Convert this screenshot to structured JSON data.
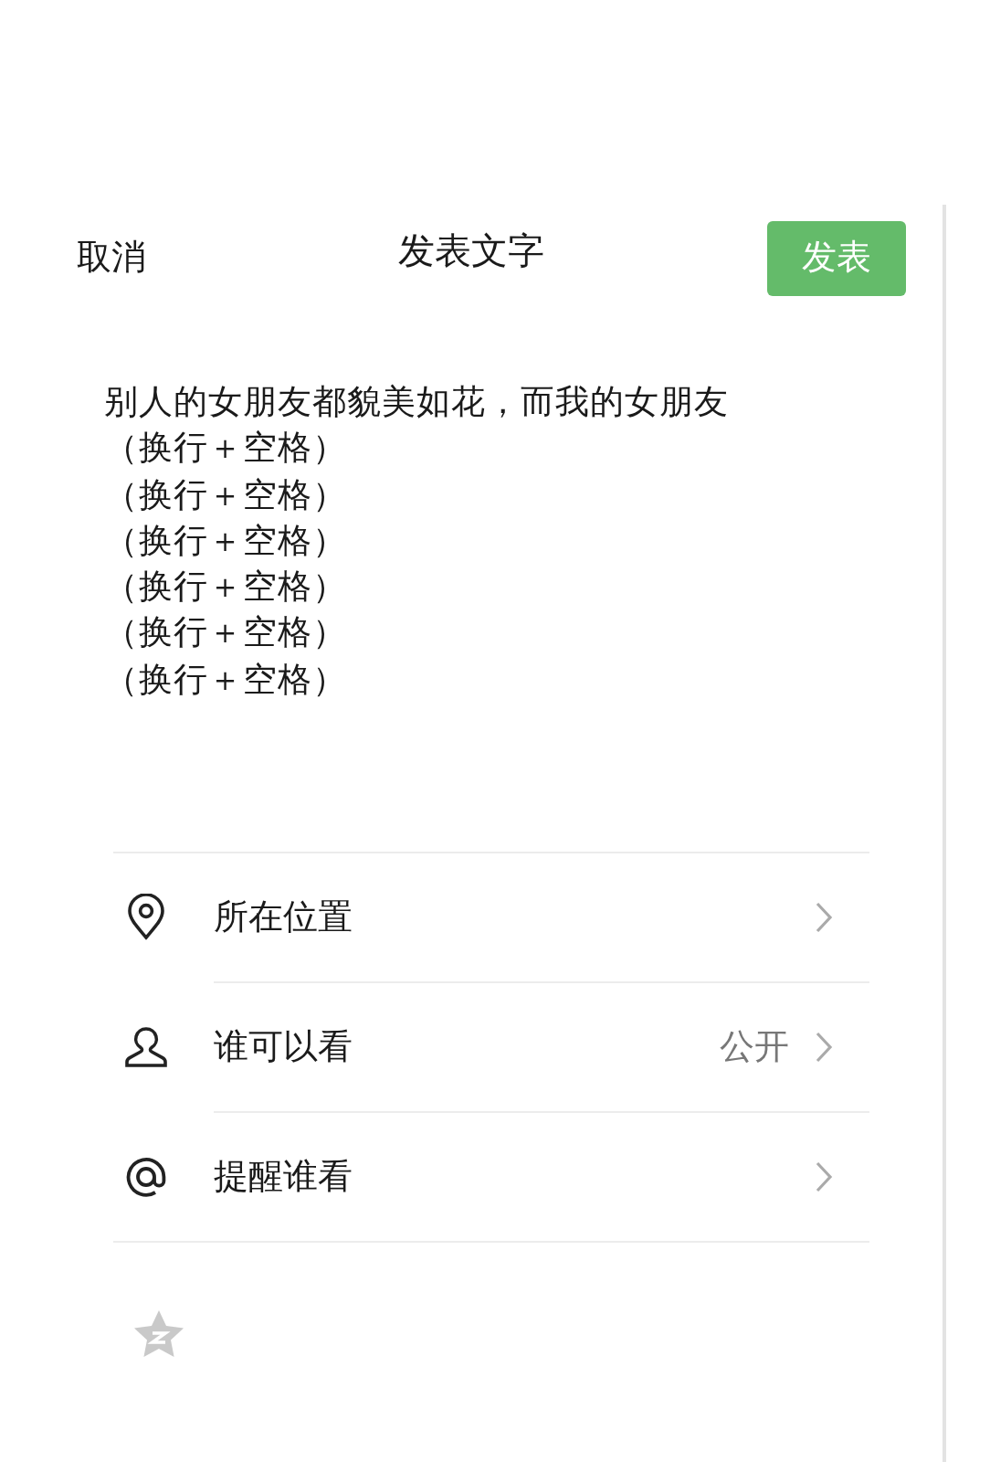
{
  "header": {
    "cancel": "取消",
    "title": "发表文字",
    "publish": "发表"
  },
  "post_text": [
    "别人的女朋友都貌美如花，而我的女朋友",
    "（换行＋空格）",
    "（换行＋空格）",
    "（换行＋空格）",
    "（换行＋空格）",
    "（换行＋空格）",
    "（换行＋空格）"
  ],
  "options": [
    {
      "kind": "location",
      "label": "所在位置"
    },
    {
      "kind": "visibility",
      "label": "谁可以看",
      "value": "公开"
    },
    {
      "kind": "mention",
      "label": "提醒谁看"
    }
  ]
}
